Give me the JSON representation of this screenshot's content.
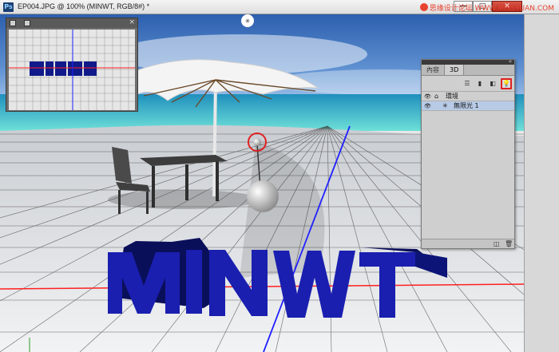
{
  "window": {
    "title": "EP004.JPG @ 100% (MINWT, RGB/8#) *",
    "app_icon_label": "Ps",
    "buttons": {
      "minimize": "—",
      "maximize": "□",
      "close": "✕"
    }
  },
  "watermark": {
    "text": "思缘设计论坛  WWW.MISSYUAN.COM"
  },
  "scene": {
    "text_3d": "MINWT",
    "colors": {
      "sky": "#3d6fb8",
      "sea": "#3fc3cc",
      "text": "#1a1fb0",
      "grid": "#404040",
      "redline": "#ff2020",
      "blueline": "#2020ff"
    }
  },
  "navigator": {
    "close_label": "×"
  },
  "panel_3d": {
    "tabs": [
      "內容",
      "3D"
    ],
    "active_tab": "3D",
    "toolbar_icons": [
      "scene-filter-icon",
      "mesh-filter-icon",
      "material-filter-icon",
      "light-filter-icon"
    ],
    "rows": [
      {
        "label": "環境",
        "icon": "environment-icon",
        "selected": false
      },
      {
        "label": "無限光 1",
        "icon": "infinite-light-icon",
        "selected": true
      }
    ],
    "collapse_label": "«"
  }
}
